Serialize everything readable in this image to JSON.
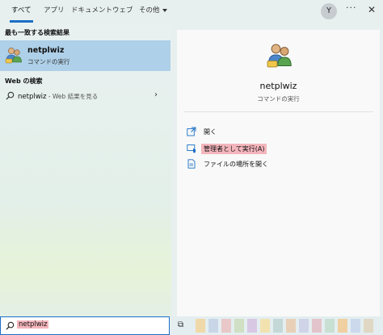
{
  "tabs": [
    {
      "label": "すべて",
      "active": true
    },
    {
      "label": "アプリ",
      "active": false
    },
    {
      "label": "ドキュメント",
      "active": false
    },
    {
      "label": "ウェブ",
      "active": false
    },
    {
      "label": "その他",
      "active": false
    }
  ],
  "header": {
    "avatar_letter": "Y",
    "more_label": "···",
    "close_label": "✕"
  },
  "best_match": {
    "section_label": "最も一致する検索結果",
    "title": "netplwiz",
    "subtitle": "コマンドの実行"
  },
  "web_search": {
    "section_label": "Web の検索",
    "query": "netplwiz",
    "suffix": " - Web 結果を見る"
  },
  "detail": {
    "title": "netplwiz",
    "subtitle": "コマンドの実行",
    "actions": [
      {
        "label": "開く",
        "icon": "open-icon",
        "highlighted": false
      },
      {
        "label": "管理者として実行(A)",
        "icon": "run-as-admin-icon",
        "highlighted": true
      },
      {
        "label": "ファイルの場所を開く",
        "icon": "file-location-icon",
        "highlighted": false
      }
    ]
  },
  "taskbar": {
    "search_value": "netplwiz",
    "tile_colors": [
      "#f0d9a8",
      "#c9d6e8",
      "#e8c8c8",
      "#cfe0c4",
      "#d8c8e4",
      "#f2e2b0",
      "#c4d8d8",
      "#e8d0b8",
      "#d0d4e8",
      "#e4c4cc",
      "#c8e0d4",
      "#f0d0a0",
      "#ccd8ec",
      "#e0d8c4"
    ]
  },
  "colors": {
    "accent": "#1a6fc6",
    "selection": "#aed0e8",
    "highlight": "#f4b6bd"
  }
}
